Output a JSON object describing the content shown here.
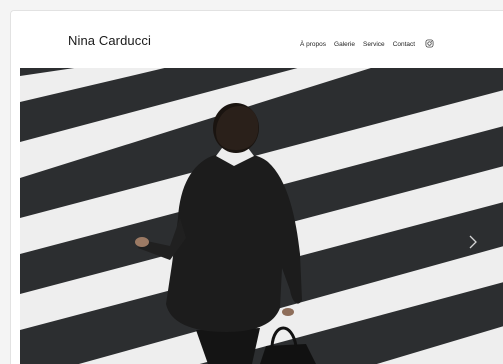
{
  "header": {
    "brand": "Nina Carducci",
    "nav": [
      {
        "label": "À propos"
      },
      {
        "label": "Galerie"
      },
      {
        "label": "Service"
      },
      {
        "label": "Contact"
      }
    ],
    "social_icon": "instagram-icon"
  },
  "hero": {
    "image": "man-in-suit-crossing-crosswalk",
    "next_control_icon": "chevron-right-icon"
  },
  "colors": {
    "page_background": "#f4f4f4",
    "header_background": "#ffffff",
    "text": "#1a1a1a",
    "asphalt": "#2c2e30",
    "stripe": "#eeeeee"
  }
}
